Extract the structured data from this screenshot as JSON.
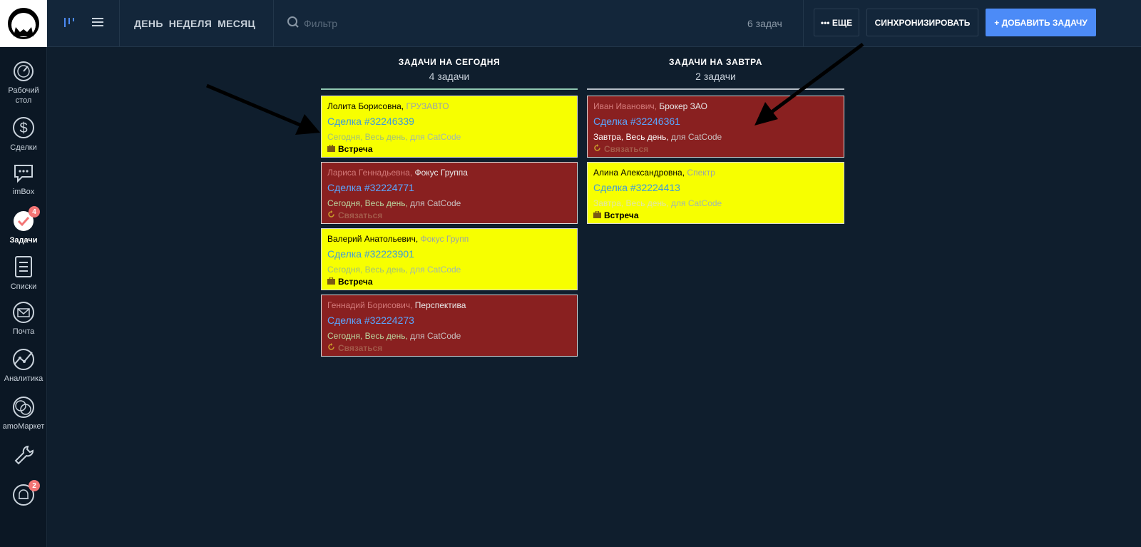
{
  "sidebar": {
    "items": [
      {
        "label": "Рабочий\nстол",
        "icon": "dashboard-icon"
      },
      {
        "label": "Сделки",
        "icon": "dollar-icon"
      },
      {
        "label": "imBox",
        "icon": "chat-icon"
      },
      {
        "label": "Задачи",
        "icon": "tasks-icon",
        "badge": "4"
      },
      {
        "label": "Списки",
        "icon": "list-icon"
      },
      {
        "label": "Почта",
        "icon": "mail-icon"
      },
      {
        "label": "Аналитика",
        "icon": "analytics-icon"
      },
      {
        "label": "amoМаркет",
        "icon": "market-icon"
      },
      {
        "label": "",
        "icon": "settings-icon"
      },
      {
        "label": "",
        "icon": "bell-icon",
        "badge": "2"
      }
    ]
  },
  "topbar": {
    "periods": [
      "ДЕНЬ",
      "НЕДЕЛЯ",
      "МЕСЯЦ"
    ],
    "filter_placeholder": "Фильтр",
    "task_count": "6 задач",
    "more_label": "••• ЕЩЕ",
    "sync_label": "СИНХРОНИЗИРОВАТЬ",
    "add_label": "+ ДОБАВИТЬ ЗАДАЧУ"
  },
  "columns": {
    "today": {
      "title": "ЗАДАЧИ НА СЕГОДНЯ",
      "count": "4 задачи",
      "cards": [
        {
          "name": "Лолита Борисовна,",
          "company": " ГРУЗАВТО",
          "deal": "Сделка #32246339",
          "when": "Сегодня, Весь день,",
          "owner": " для CatCode",
          "type": "Встреча"
        },
        {
          "name": "Лариса Геннадьевна,",
          "company": " Фокус Группа",
          "deal": "Сделка #32224771",
          "when": "Сегодня, Весь день,",
          "owner": " для CatCode",
          "type": "Связаться"
        },
        {
          "name": "Валерий Анатольевич,",
          "company": " Фокус Групп",
          "deal": "Сделка #32223901",
          "when": "Сегодня, Весь день,",
          "owner": " для CatCode",
          "type": "Встреча"
        },
        {
          "name": "Геннадий Борисович,",
          "company": " Перспектива",
          "deal": "Сделка #32224273",
          "when": "Сегодня, Весь день,",
          "owner": " для CatCode",
          "type": "Связаться"
        }
      ]
    },
    "tomorrow": {
      "title": "ЗАДАЧИ НА ЗАВТРА",
      "count": "2 задачи",
      "cards": [
        {
          "name": "Иван Иванович,",
          "company": " Брокер ЗАО",
          "deal": "Сделка #32246361",
          "when": "Завтра, Весь день,",
          "owner": " для CatCode",
          "type": "Связаться"
        },
        {
          "name": "Алина Александровна,",
          "company": " Спектр",
          "deal": "Сделка #32224413",
          "when": "Завтра, Весь день,",
          "owner": " для CatCode",
          "type": "Встреча"
        }
      ]
    }
  },
  "colors": {
    "yellow_card": "#f7ff00",
    "red_card": "#892020",
    "accent": "#4c8bf7",
    "background": "#0f1e2d"
  }
}
